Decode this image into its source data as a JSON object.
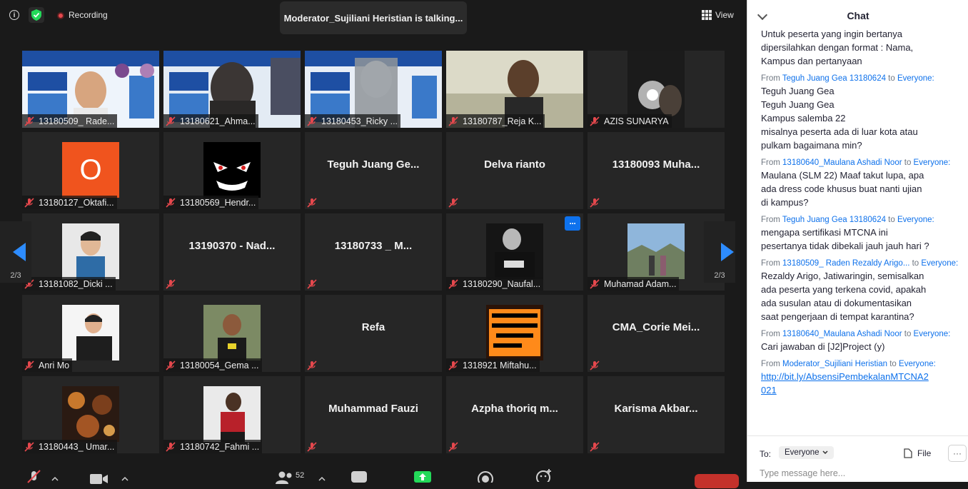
{
  "topbar": {
    "recording_label": "Recording",
    "talking_banner": "Moderator_Sujiliani Heristian is talking...",
    "view_label": "View"
  },
  "tiles": [
    {
      "name": "13180509_ Rade...",
      "kind": "video",
      "scene": "banner-person"
    },
    {
      "name": "13180621_Ahma...",
      "kind": "video",
      "scene": "banner-dark"
    },
    {
      "name": "13180453_Ricky ...",
      "kind": "video",
      "scene": "banner-blur"
    },
    {
      "name": "13180787_Reja K...",
      "kind": "video",
      "scene": "person-room"
    },
    {
      "name": "AZIS SUNARYA",
      "kind": "video",
      "scene": "dark-light"
    },
    {
      "name": "13180127_Oktafi...",
      "kind": "avatar",
      "letter": "O",
      "color": "#f0541e"
    },
    {
      "name": "13180569_Hendr...",
      "kind": "avatar",
      "scene": "evil-face"
    },
    {
      "name": "",
      "kind": "name",
      "display": "Teguh Juang Ge..."
    },
    {
      "name": "",
      "kind": "name",
      "display": "Delva rianto"
    },
    {
      "name": "",
      "kind": "name",
      "display": "13180093 Muha..."
    },
    {
      "name": "13181082_Dicki ...",
      "kind": "avatar",
      "scene": "portrait-blue"
    },
    {
      "name": "",
      "kind": "name",
      "display": "13190370 - Nad..."
    },
    {
      "name": "",
      "kind": "name",
      "display": "13180733 _ M..."
    },
    {
      "name": "13180290_Naufal...",
      "kind": "avatar",
      "scene": "dark-shirt",
      "more": true
    },
    {
      "name": "Muhamad Adam...",
      "kind": "avatar",
      "scene": "landscape"
    },
    {
      "name": "Anri Mo",
      "kind": "avatar",
      "scene": "white-hoodie"
    },
    {
      "name": "13180054_Gema ...",
      "kind": "avatar",
      "scene": "outdoor-smile"
    },
    {
      "name": "",
      "kind": "name",
      "display": "Refa"
    },
    {
      "name": "1318921 Miftahu...",
      "kind": "avatar",
      "scene": "sign"
    },
    {
      "name": "",
      "kind": "name",
      "display": "CMA_Corie  Mei..."
    },
    {
      "name": "13180443_ Umar...",
      "kind": "avatar",
      "scene": "pattern"
    },
    {
      "name": "13180742_Fahmi ...",
      "kind": "avatar",
      "scene": "red-shirt"
    },
    {
      "name": "",
      "kind": "name",
      "display": "Muhammad Fauzi"
    },
    {
      "name": "",
      "kind": "name",
      "display": "Azpha thoriq m..."
    },
    {
      "name": "",
      "kind": "name",
      "display": "Karisma  Akbar..."
    }
  ],
  "more_button_label": "···",
  "pagination": {
    "left": "2/3",
    "right": "2/3"
  },
  "toolbar": {
    "participants_count": "52"
  },
  "chat": {
    "title": "Chat",
    "messages": [
      {
        "from": "",
        "to": "",
        "lines": [
          "Untuk peserta yang ingin bertanya",
          "dipersilahkan dengan format : Nama,",
          "Kampus dan pertanyaan"
        ]
      },
      {
        "from": "Teguh Juang Gea 13180624",
        "to": "Everyone:",
        "lines": [
          "Teguh Juang Gea",
          "Teguh Juang Gea",
          "Kampus salemba 22",
          "misalnya peserta ada di luar kota atau",
          "pulkam bagaimana min?"
        ]
      },
      {
        "from": "13180640_Maulana Ashadi Noor",
        "to": "Everyone:",
        "lines": [
          "Maulana (SLM 22) Maaf takut lupa, apa",
          "ada dress code khusus buat nanti ujian",
          "di kampus?"
        ]
      },
      {
        "from": "Teguh Juang Gea 13180624",
        "to": "Everyone:",
        "lines": [
          "mengapa sertifikasi MTCNA ini",
          "pesertanya tidak dibekali jauh jauh hari ?"
        ]
      },
      {
        "from": "13180509_ Raden Rezaldy Arigo...",
        "to": "Everyone:",
        "lines": [
          "Rezaldy Arigo, Jatiwaringin, semisalkan",
          "ada peserta yang terkena covid, apakah",
          "ada susulan atau di dokumentasikan",
          "saat pengerjaan di tempat karantina?"
        ]
      },
      {
        "from": "13180640_Maulana Ashadi Noor",
        "to": "Everyone:",
        "lines": [
          "Cari jawaban di [J2]Project (y)"
        ]
      },
      {
        "from": "Moderator_Sujiliani Heristian",
        "to": "Everyone:",
        "link": [
          "http://bit.ly/AbsensiPembekalanMTCNA2",
          "021"
        ]
      }
    ],
    "from_prefix": "From",
    "to_word": "to",
    "to_label": "To:",
    "to_value": "Everyone",
    "file_label": "File",
    "more_label": "···",
    "input_placeholder": "Type message here..."
  },
  "colors": {
    "accent": "#0e71eb",
    "tile_bg": "#262626",
    "end_red": "#c4312b",
    "green": "#23d959"
  }
}
